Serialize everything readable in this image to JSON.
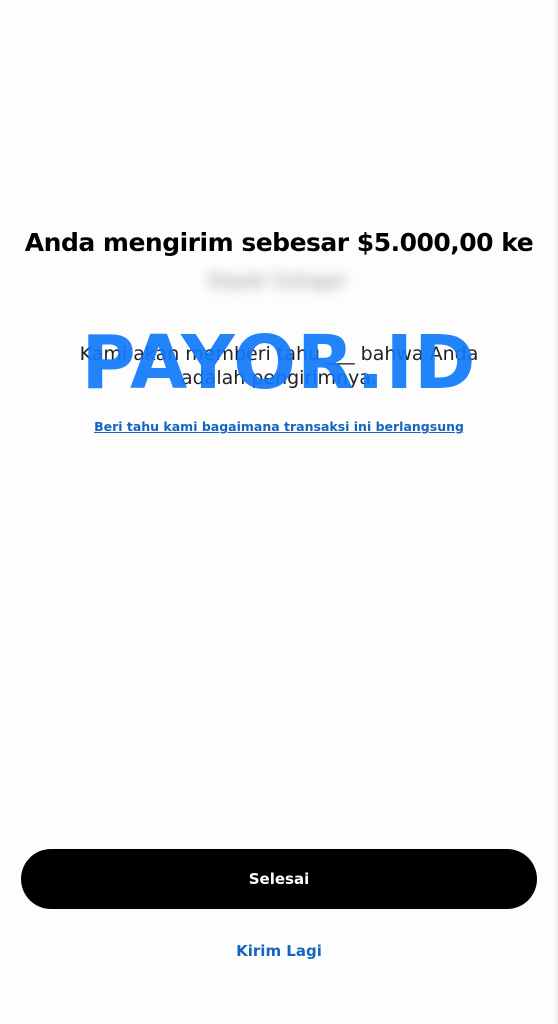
{
  "confirmation": {
    "headline": "Anda mengirim sebesar $5.000,00 ke",
    "recipient_name": "Bapak Sukagar",
    "message": "Kami akan memberi tahu ___ bahwa Anda adalah pengirimnya.",
    "feedback_link": "Beri tahu kami bagaimana transaksi ini berlangsung"
  },
  "watermark": {
    "text": "PAYOR.ID",
    "color": "#0f78fa"
  },
  "actions": {
    "done_label": "Selesai",
    "send_again_label": "Kirim Lagi"
  },
  "colors": {
    "link": "#1565c0",
    "button_bg": "#000000",
    "button_text": "#ffffff"
  }
}
